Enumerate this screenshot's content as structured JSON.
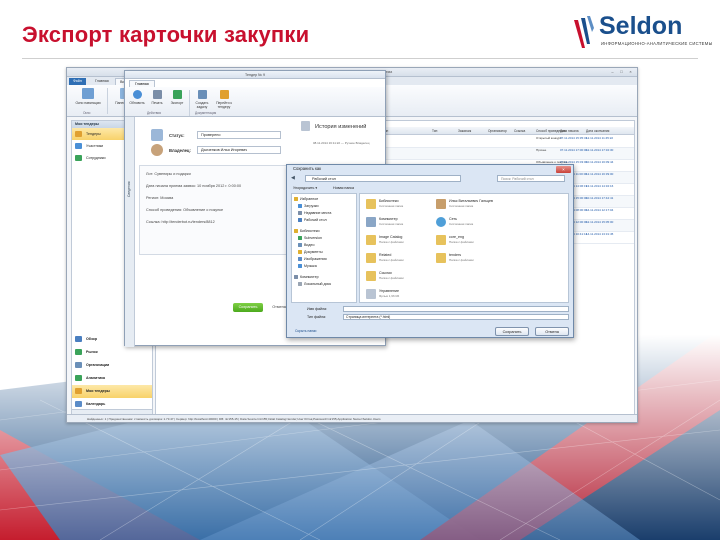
{
  "slide": {
    "title": "Экспорт карточки закупки"
  },
  "logo": {
    "word": "Seldon",
    "tagline": "ИНФОРМАЦИОННО-АНАЛИТИЧЕСКИЕ СИСТЕМЫ",
    "color": "#1a4f8c",
    "accent": "#c8102e"
  },
  "app": {
    "title": "Seldon — информационно-аналитическая система",
    "tabs": [
      "Файл",
      "Главная",
      "Вид"
    ],
    "ribbon_buttons": [
      "Окно навигации",
      "Панель задач",
      "Панель предпросмотра",
      "Строка информации",
      "Многоэтапный вид",
      "Представление",
      "Сбросить вид"
    ],
    "ribbon_groups": [
      "Окно",
      "Рабочее пространство",
      "Представление"
    ],
    "nav_header": "Мои тендеры",
    "nav_items": [
      "Тендеры",
      "Участники",
      "Сотрудники"
    ],
    "nav_lower": [
      "Обзор",
      "Рынок",
      "Организации",
      "Аналитика",
      "Мои тендеры",
      "Календарь",
      "Контакты"
    ],
    "grid_tab": "Тендеры",
    "grid_columns": [
      "№ тенд",
      "Статус",
      "Владелец",
      "Тендер",
      "Дата начала приема заявок",
      "Регион",
      "Тип",
      "Заказчик",
      "Организатор",
      "Ссылка",
      "Способ проведения",
      "Дата начала",
      "Дата окончания"
    ],
    "rows": [
      {
        "num": "1",
        "tender": "Услуги по подготовке и подаче возражений на",
        "method": "Открытый конкурс",
        "start": "07.11.2014 15:35:31",
        "end": "12.11.2014 11:45:22"
      },
      {
        "num": "2",
        "tender": "",
        "method": "Прочее",
        "start": "07.11.2014 17:00:00",
        "end": "12.11.2014 17:32:30"
      },
      {
        "num": "3",
        "tender": "",
        "method": "Объявление о покупке",
        "start": "07.11.2014 15:03:00",
        "end": "10.11.2014 16:09:44"
      },
      {
        "num": "4",
        "tender": "",
        "method": "Запрос котировок",
        "start": "08.11.2014 11:00:00",
        "end": "12.11.2014 16:39:00"
      },
      {
        "num": "5",
        "tender": "",
        "method": "Открытый аукцион",
        "start": "08.11.2014 14:06:19",
        "end": "13.11.2014 14:32:16"
      },
      {
        "num": "6",
        "tender": "",
        "method": "Запрос котировок",
        "start": "08.11.2014 15:00:00",
        "end": "10.11.2014 17:42:41"
      },
      {
        "num": "7",
        "tender": "",
        "method": "Открытый аукцион",
        "start": "10.11.2014 08:00:00",
        "end": "14.11.2014 12:17:04"
      },
      {
        "num": "8",
        "tender": "",
        "method": "Открытый конкурс",
        "start": "10.11.2014 12:00:00",
        "end": "12.11.2014 15:05:00"
      },
      {
        "num": "9",
        "tender": "",
        "method": "Открытый аукцион",
        "start": "10.11.2014 10:41:11",
        "end": "14.11.2014 13:31:45"
      }
    ],
    "status_bar": "Найденных: 1 | Предшественник: стоимость договора: 1.73.47 | Сервер: http://localhost:40000 | DB: ntr155-15 | Data Source=ntr155;Initial Catalog=tender;User ID=sa;Password=ntr155;Application Name=Seldon.Users"
  },
  "card": {
    "window_title": "Тендер № 9",
    "tab": "Главная",
    "toolbar": [
      "Обновить",
      "Печать",
      "Экспорт",
      "Создать задачу",
      "Перейти к тендеру"
    ],
    "toolbar_groups": [
      "Действия",
      "Документация"
    ],
    "side_label": "Сведения",
    "status_label": "Статус:",
    "status_value": "Проверено",
    "owner_label": "Владелец:",
    "owner_value": "Дьяченков Илья Игоревич",
    "info_lines": [
      "Лот: Сувениры и подарки",
      "Дата начала приема заявок: 10 ноября 2012 г. 0:00:00",
      "Регион: Москва",
      "Способ проведения: Объявление о покупке",
      "Ссылка: http://tenderbot.ru/tenders/8812"
    ],
    "save": "Сохранить",
    "cancel": "Отмена",
    "history_title": "История изменений",
    "history_line": "08.11.2014 16:11:22 — Ручное Владелец"
  },
  "dialog": {
    "title": "Сохранить как",
    "path": "Рабочий стол",
    "search_placeholder": "Поиск: Рабочий стол",
    "toolbar": [
      "Упорядочить ▾",
      "Новая папка"
    ],
    "tree": [
      "Избранное",
      "Загрузки",
      "Недавние места",
      "Рабочий стол",
      "Библиотеки",
      "Subversion",
      "Видео",
      "Документы",
      "Изображения",
      "Музыка",
      "Компьютер",
      "Локальный диск"
    ],
    "files": [
      {
        "name": "Библиотеки",
        "sub": "Системная папка"
      },
      {
        "name": "Илья Витальевич Гальцев",
        "sub": "Системная папка"
      },
      {
        "name": "Компьютер",
        "sub": "Системная папка"
      },
      {
        "name": "Сеть",
        "sub": "Системная папка"
      },
      {
        "name": "Image Catalog",
        "sub": "Папка с файлами"
      },
      {
        "name": "core_eng",
        "sub": "Папка с файлами"
      },
      {
        "name": "Related",
        "sub": "Папка с файлами"
      },
      {
        "name": "tenders",
        "sub": "Папка с файлами"
      },
      {
        "name": "Ссылки",
        "sub": "Папка с файлами"
      },
      {
        "name": "Управление",
        "sub": "Ярлык 1,96 КБ"
      }
    ],
    "filename_label": "Имя файла:",
    "filename_value": "",
    "filetype_label": "Тип файла:",
    "filetype_value": "Страница интернета (*.html)",
    "hide_folders": "Скрыть папки",
    "save": "Сохранить",
    "cancel": "Отмена"
  }
}
